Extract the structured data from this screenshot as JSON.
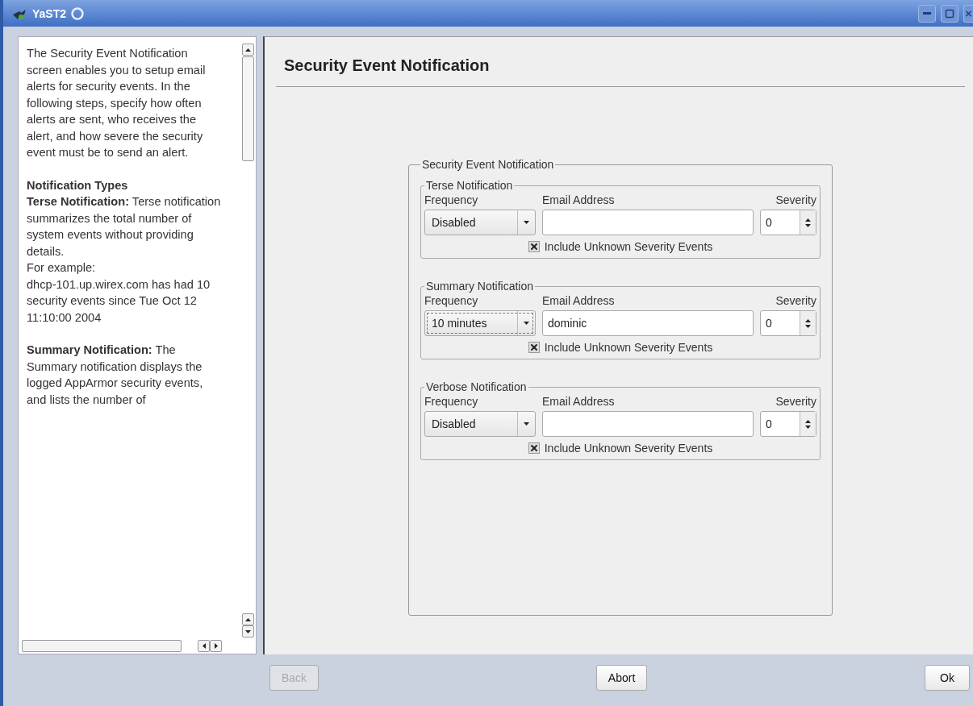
{
  "window": {
    "title": "YaST2"
  },
  "help": [
    {
      "kind": "para",
      "text": "The Security Event Notification screen enables you to setup email alerts for security events. In the following steps, specify how often alerts are sent, who receives the alert, and how severe the security event must be to send an alert."
    },
    {
      "kind": "heading",
      "text": "Notification Types"
    },
    {
      "kind": "line",
      "text": "**Terse Notification:** Terse notification summarizes the total number of system events without providing details."
    },
    {
      "kind": "line",
      "text": "For example:"
    },
    {
      "kind": "para",
      "text": "dhcp-101.up.wirex.com has had 10 security events since Tue Oct 12 11:10:00 2004"
    },
    {
      "kind": "para",
      "text": "**Summary Notification:** The Summary notification displays the logged AppArmor security events, and lists the number of"
    }
  ],
  "page_title": "Security Event Notification",
  "frame_title": "Security Event Notification",
  "groups": [
    {
      "title": "Terse Notification",
      "frequency_label": "Frequency",
      "email_label": "Email Address",
      "severity_label": "Severity",
      "frequency": "Disabled",
      "frequency_focused": false,
      "severity": "0",
      "include_label": "Include Unknown Severity Events",
      "include_checked": true
    },
    {
      "title": "Summary Notification",
      "frequency_label": "Frequency",
      "email_label": "Email Address",
      "severity_label": "Severity",
      "frequency": "10 minutes",
      "frequency_focused": true,
      "email": "dominic",
      "severity": "0",
      "include_label": "Include Unknown Severity Events",
      "include_checked": true
    },
    {
      "title": "Verbose Notification",
      "frequency_label": "Frequency",
      "email_label": "Email Address",
      "severity_label": "Severity",
      "frequency": "Disabled",
      "frequency_focused": false,
      "severity": "0",
      "include_label": "Include Unknown Severity Events",
      "include_checked": true
    }
  ],
  "buttons": [
    {
      "label": "Back",
      "disabled": true
    },
    {
      "label": "Abort",
      "disabled": false
    },
    {
      "label": "Ok",
      "disabled": false
    }
  ]
}
